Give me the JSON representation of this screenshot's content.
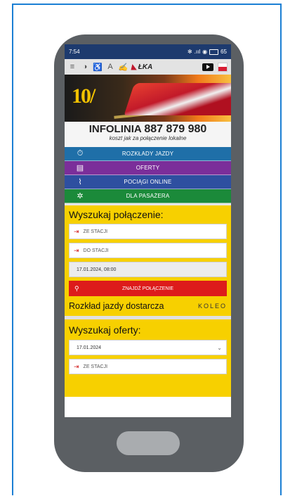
{
  "status_bar": {
    "time": "7:54",
    "bluetooth": "✻",
    "signal": ".ııl",
    "wifi": "◉",
    "battery": "65"
  },
  "toolbar": {
    "menu_icon": "≡",
    "contrast_icon": "◑",
    "accessibility_icon": "♿",
    "font_icon": "A",
    "sign_language_icon": "🤟",
    "lka_label": "ŁKA"
  },
  "banner": {
    "logo_text": "10/"
  },
  "hotline": {
    "label": "INFOLINIA",
    "number": "887 879 980",
    "subtitle": "koszt jak za połączenie lokalne"
  },
  "nav": [
    {
      "label": "ROZKŁADY JAZDY",
      "color": "#1f6fa8"
    },
    {
      "label": "OFERTY",
      "color": "#7b2e9a"
    },
    {
      "label": "POCIĄGI ONLINE",
      "color": "#2e4fa0"
    },
    {
      "label": "DLA PASAŻERA",
      "color": "#1b8a3a"
    }
  ],
  "search": {
    "title": "Wyszukaj połączenie:",
    "from_placeholder": "ZE STACJI",
    "to_placeholder": "DO STACJI",
    "datetime_value": "17.01.2024, 08:00",
    "find_button": "ZNAJDŹ POŁĄCZENIE",
    "provider_text": "Rozkład jazdy dostarcza",
    "provider_brand": "KOLEO"
  },
  "offers": {
    "title": "Wyszukaj oferty:",
    "date_value": "17.01.2024",
    "from_placeholder": "ZE STACJI"
  },
  "colors": {
    "yellow": "#f7d000",
    "red": "#dd1b1b",
    "frame": "#1b7fd4"
  }
}
